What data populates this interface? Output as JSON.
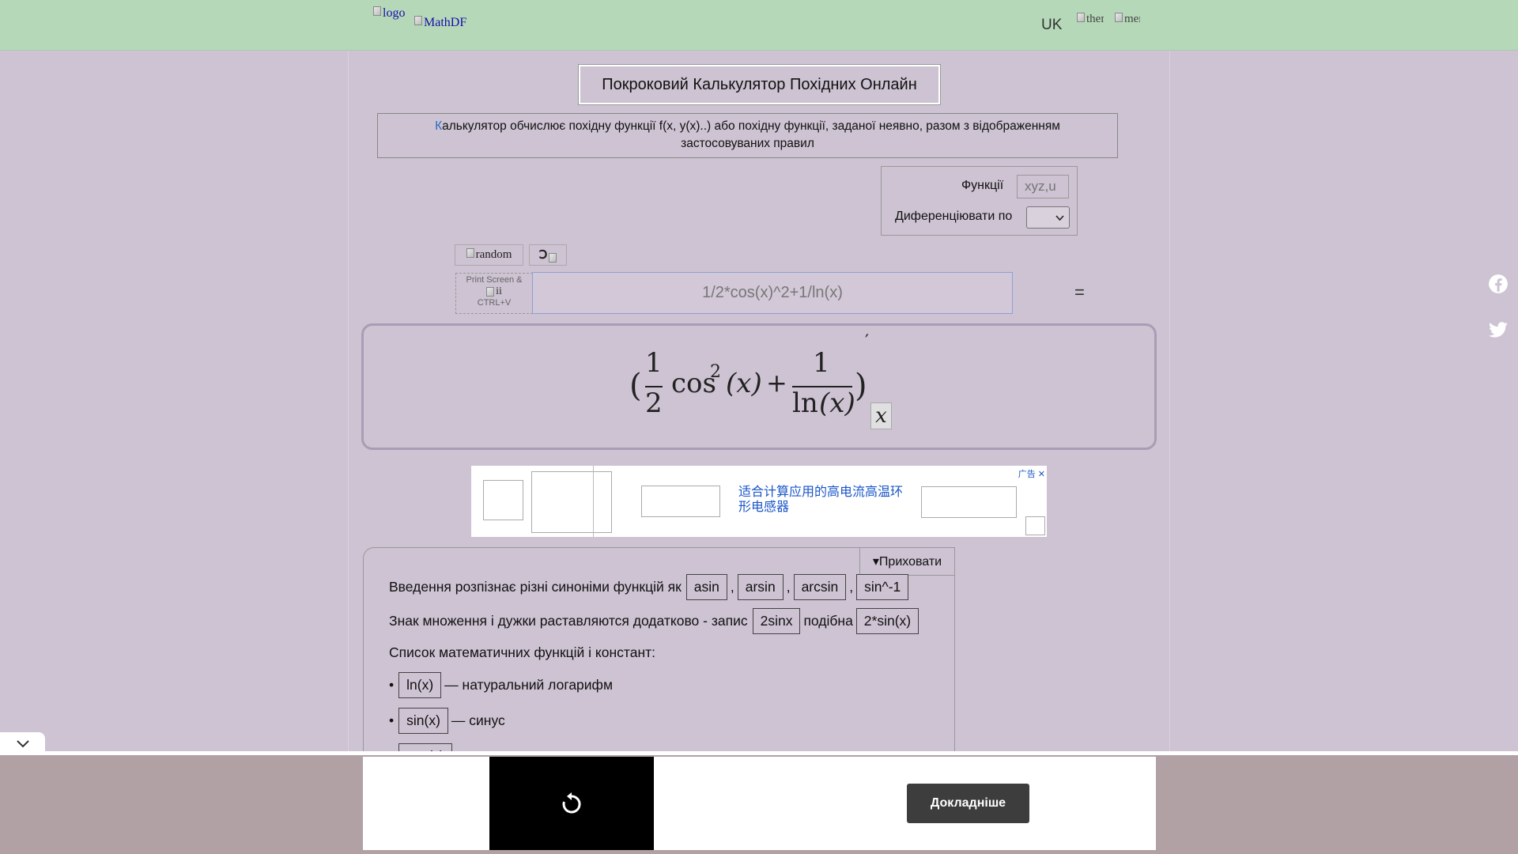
{
  "header": {
    "logo_alt": "logo",
    "brand_alt": "MathDF",
    "language": "UK",
    "theme_alt": "theme",
    "menu_alt": "menu"
  },
  "title": "Покроковий Калькулятор Похідних Онлайн",
  "description": {
    "first_letter": "К",
    "rest": "алькулятор обчислює похідну функції f(x, y(x)..) або похідну функції, заданої неявно, разом з відображенням застосовуваних правил"
  },
  "options": {
    "functions_label": "Функції",
    "functions_placeholder": "xyz,u",
    "differentiate_label": "Диференціювати по",
    "differentiate_value": ""
  },
  "tools": {
    "random_alt": "random",
    "undo_glyph": "Ↄ",
    "paste_top": "Print Screen &",
    "paste_bottom": "CTRL+V"
  },
  "input": {
    "placeholder": "1/2*cos(x)^2+1/ln(x)"
  },
  "equals": "=",
  "formula": {
    "open_paren": "(",
    "close_paren": ")",
    "num1": "1",
    "den1": "2",
    "cos": "cos",
    "exp": "2",
    "arg1": "(x)",
    "plus": "+",
    "num2": "1",
    "ln": "ln",
    "arg2": "(x)",
    "prime": "′",
    "var": "x"
  },
  "ad": {
    "text": "适合计算应用的高电流高温环形电感器",
    "choices": "广告 ✕"
  },
  "help": {
    "hide_label": "▾Приховати",
    "line1_text": "Введення розпізнає різні синоніми функцій як",
    "synonyms": [
      "asin",
      "arsin",
      "arcsin",
      "sin^-1"
    ],
    "line2_text": "Знак множення і дужки раставляются додатково - запис",
    "line2_example": "2sinx",
    "line2_mid": "подібна",
    "line2_result": "2*sin(x)",
    "list_title": "Список математичних функцій і констант:",
    "items": [
      {
        "bullet": "•",
        "chip": "ln(x)",
        "desc": "— натуральний логарифм"
      },
      {
        "bullet": "•",
        "chip": "sin(x)",
        "desc": "— синус"
      },
      {
        "bullet": "•",
        "chip": "cos(x)",
        "desc": ""
      }
    ]
  },
  "bottom": {
    "more_label": "Докладніше"
  },
  "colors": {
    "header_bg": "#b5d9b8",
    "page_bg": "#cdc3d2",
    "bottom_bar": "#b2a1a4",
    "accent": "#2a6fbf"
  }
}
